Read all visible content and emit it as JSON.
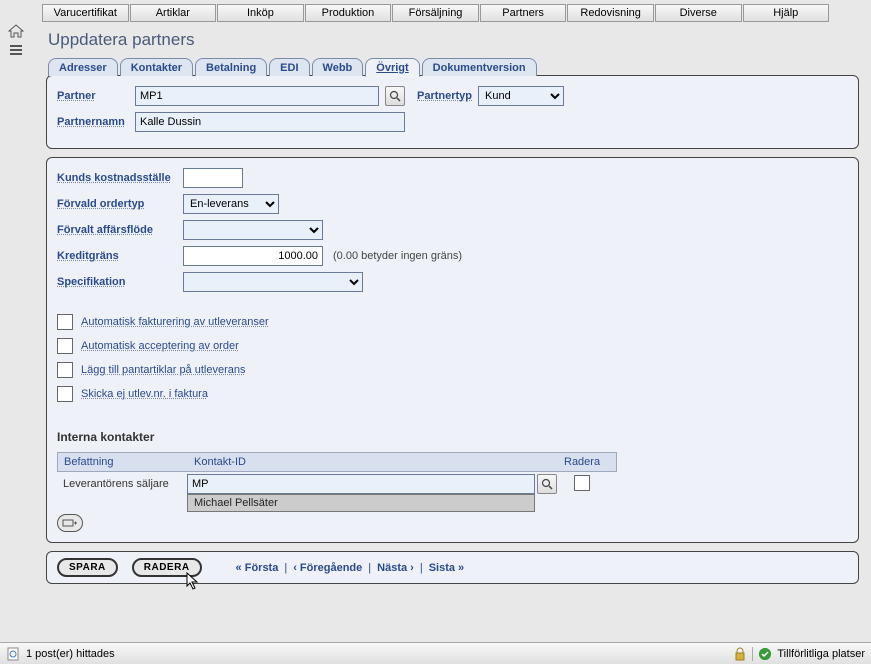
{
  "topmenu": [
    "Varucertifikat",
    "Artiklar",
    "Inköp",
    "Produktion",
    "Försäljning",
    "Partners",
    "Redovisning",
    "Diverse",
    "Hjälp"
  ],
  "page_title": "Uppdatera partners",
  "tabs": [
    {
      "label": "Adresser"
    },
    {
      "label": "Kontakter"
    },
    {
      "label": "Betalning"
    },
    {
      "label": "EDI"
    },
    {
      "label": "Webb"
    },
    {
      "label": "Övrigt"
    },
    {
      "label": "Dokumentversion"
    }
  ],
  "active_tab": 5,
  "top_form": {
    "partner_label": "Partner",
    "partner_value": "MP1",
    "partnertyp_label": "Partnertyp",
    "partnertyp_value": "Kund",
    "partnernamn_label": "Partnernamn",
    "partnernamn_value": "Kalle Dussin"
  },
  "form": {
    "kostnad_label": "Kunds kostnadsställe",
    "kostnad_value": "",
    "ordertyp_label": "Förvald ordertyp",
    "ordertyp_value": "En-leverans",
    "affarsflode_label": "Förvalt affärsflöde",
    "affarsflode_value": "",
    "kredit_label": "Kreditgräns",
    "kredit_value": "1000.00",
    "kredit_hint": "(0.00 betyder ingen gräns)",
    "spec_label": "Specifikation",
    "spec_value": ""
  },
  "checkboxes": [
    "Automatisk fakturering av utleveranser",
    "Automatisk acceptering av order",
    "Lägg till pantartiklar på utleverans",
    "Skicka ej utlev.nr. i faktura"
  ],
  "interna_title": "Interna kontakter",
  "grid": {
    "headers": {
      "befattning": "Befattning",
      "kontakt": "Kontakt-ID",
      "radera": "Radera"
    },
    "row": {
      "befattning": "Leverantörens säljare",
      "kontakt_value": "MP",
      "autocomplete": "Michael Pellsäter"
    }
  },
  "footer": {
    "save": "SPARA",
    "delete": "RADERA",
    "first": "« Första",
    "prev": "‹ Föregående",
    "next": "Nästa ›",
    "last": "Sista »"
  },
  "status": {
    "left": "1 post(er) hittades",
    "right": "Tillförlitliga platser"
  }
}
